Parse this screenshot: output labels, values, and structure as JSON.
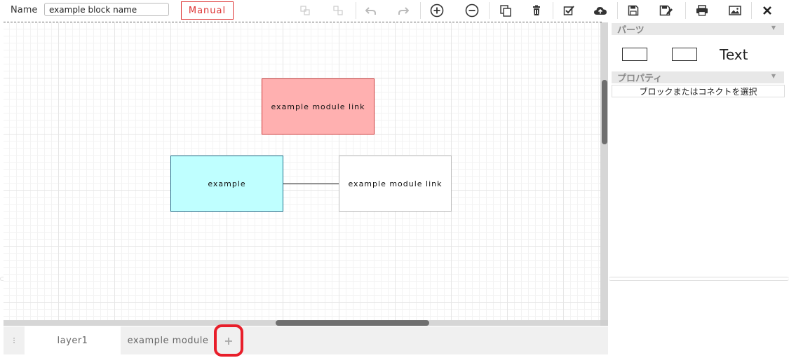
{
  "header": {
    "name_label": "Name",
    "name_value": "example block name",
    "manual_label": "Manual"
  },
  "toolbar": {
    "icons": [
      "group-icon",
      "ungroup-icon",
      "undo-icon",
      "redo-icon",
      "zoom-in-icon",
      "zoom-out-icon",
      "copy-icon",
      "delete-icon",
      "validate-icon",
      "upload-icon",
      "save-icon",
      "save-as-icon",
      "print-icon",
      "image-export-icon",
      "close-icon"
    ]
  },
  "canvas": {
    "blocks": [
      {
        "label": "example module link",
        "fill": "#ffb0b0",
        "border": "#cc3333"
      },
      {
        "label": "example",
        "fill": "#bfffff",
        "border": "#1a6f8a"
      },
      {
        "label": "example module link",
        "fill": "#ffffff",
        "border": "#bbbbbb"
      }
    ]
  },
  "tabs": {
    "items": [
      {
        "label": "layer1",
        "active": true
      },
      {
        "label": "example module",
        "active": false
      }
    ],
    "add_label": "+"
  },
  "panel": {
    "parts_title": "パーツ",
    "parts_text_label": "Text",
    "properties_title": "プロパティ",
    "properties_message": "ブロックまたはコネクトを選択"
  },
  "colors": {
    "accent_red": "#e81e2a",
    "manual_red": "#dd3333",
    "scroll_thumb": "#6f6f6f"
  }
}
